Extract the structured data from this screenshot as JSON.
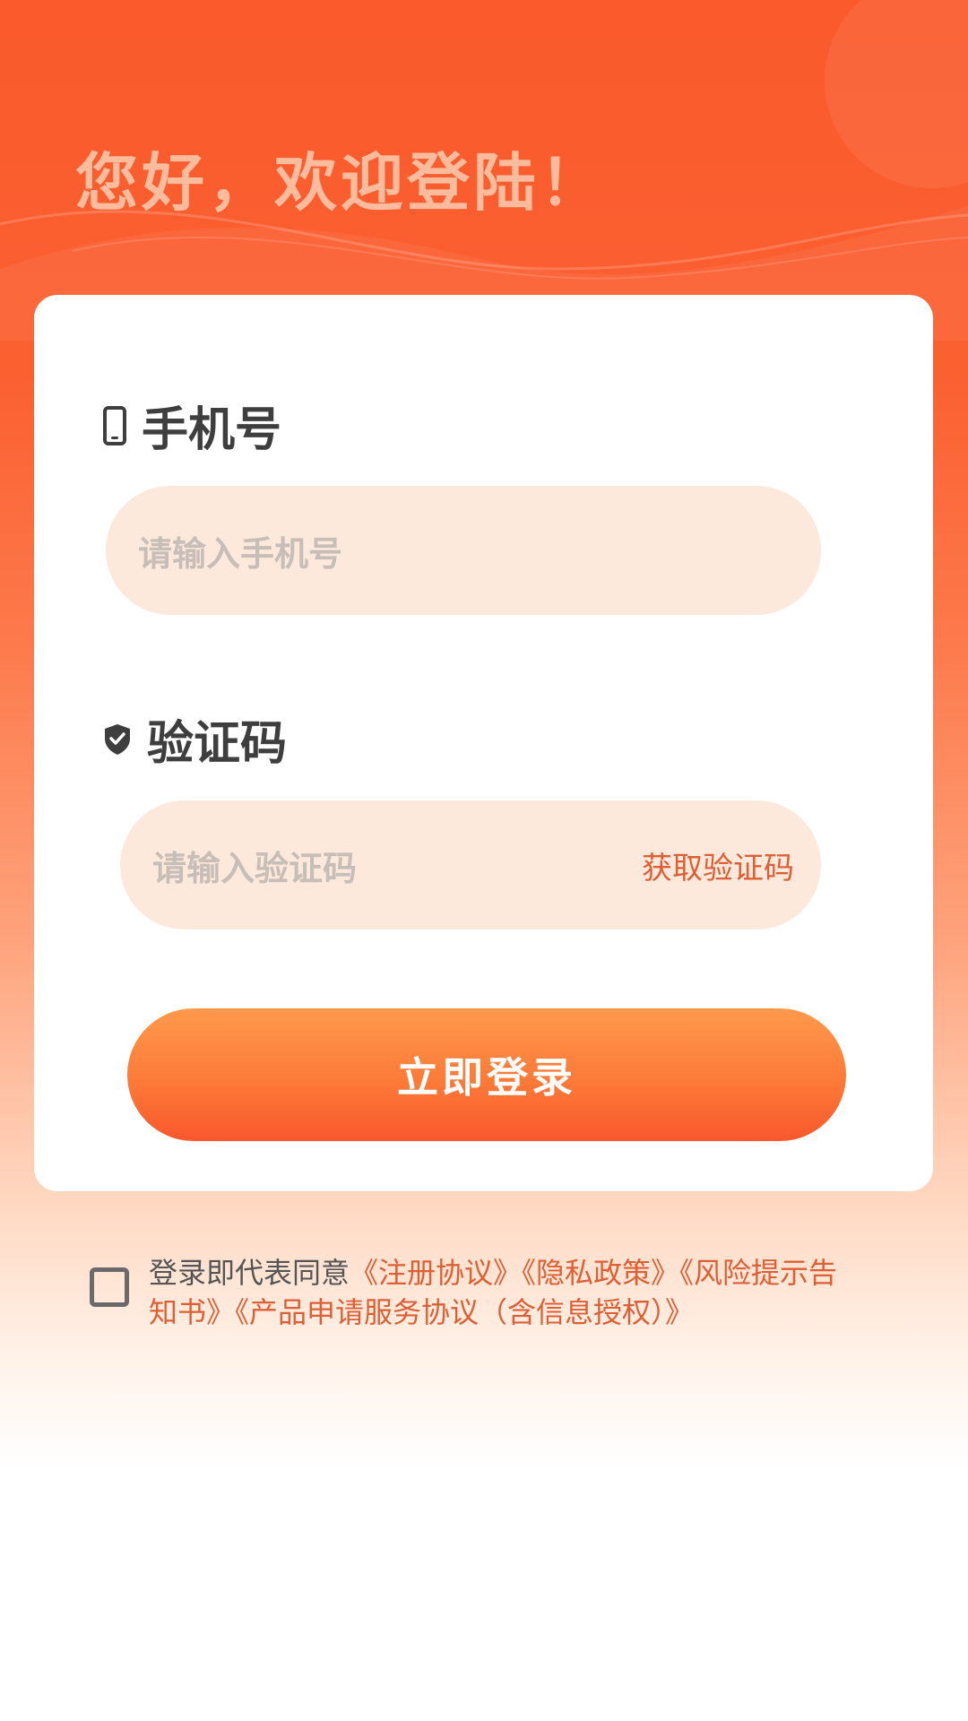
{
  "greeting": "您好，欢迎登陆！",
  "phone": {
    "label": "手机号",
    "icon": "mobile-phone-icon",
    "placeholder": "请输入手机号"
  },
  "code": {
    "label": "验证码",
    "icon": "shield-check-icon",
    "placeholder": "请输入验证码",
    "get_code_label": "获取验证码"
  },
  "login_button": "立即登录",
  "agreement": {
    "checked": false,
    "prefix": "登录即代表同意",
    "links": [
      "《注册协议》",
      "《隐私政策》",
      "《风险提示告知书》",
      "《产品申请服务协议（含信息授权）》"
    ]
  },
  "colors": {
    "accent": "#fa5a2c",
    "link": "#dd5f34",
    "input_bg": "#fde8dc",
    "button_start": "#ff9a4c",
    "button_end": "#f9582c"
  }
}
